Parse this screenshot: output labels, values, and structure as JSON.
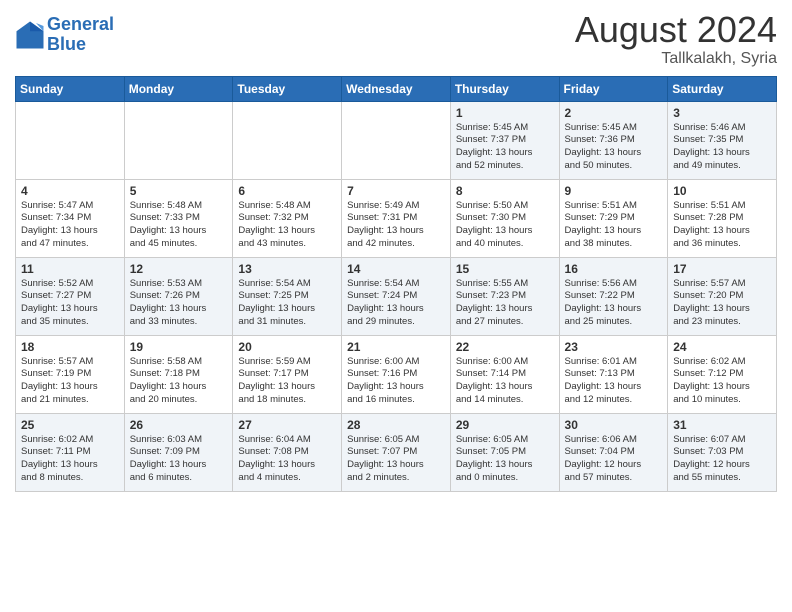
{
  "header": {
    "logo_line1": "General",
    "logo_line2": "Blue",
    "month_year": "August 2024",
    "location": "Tallkalakh, Syria"
  },
  "weekdays": [
    "Sunday",
    "Monday",
    "Tuesday",
    "Wednesday",
    "Thursday",
    "Friday",
    "Saturday"
  ],
  "weeks": [
    [
      {
        "day": "",
        "info": ""
      },
      {
        "day": "",
        "info": ""
      },
      {
        "day": "",
        "info": ""
      },
      {
        "day": "",
        "info": ""
      },
      {
        "day": "1",
        "info": "Sunrise: 5:45 AM\nSunset: 7:37 PM\nDaylight: 13 hours\nand 52 minutes."
      },
      {
        "day": "2",
        "info": "Sunrise: 5:45 AM\nSunset: 7:36 PM\nDaylight: 13 hours\nand 50 minutes."
      },
      {
        "day": "3",
        "info": "Sunrise: 5:46 AM\nSunset: 7:35 PM\nDaylight: 13 hours\nand 49 minutes."
      }
    ],
    [
      {
        "day": "4",
        "info": "Sunrise: 5:47 AM\nSunset: 7:34 PM\nDaylight: 13 hours\nand 47 minutes."
      },
      {
        "day": "5",
        "info": "Sunrise: 5:48 AM\nSunset: 7:33 PM\nDaylight: 13 hours\nand 45 minutes."
      },
      {
        "day": "6",
        "info": "Sunrise: 5:48 AM\nSunset: 7:32 PM\nDaylight: 13 hours\nand 43 minutes."
      },
      {
        "day": "7",
        "info": "Sunrise: 5:49 AM\nSunset: 7:31 PM\nDaylight: 13 hours\nand 42 minutes."
      },
      {
        "day": "8",
        "info": "Sunrise: 5:50 AM\nSunset: 7:30 PM\nDaylight: 13 hours\nand 40 minutes."
      },
      {
        "day": "9",
        "info": "Sunrise: 5:51 AM\nSunset: 7:29 PM\nDaylight: 13 hours\nand 38 minutes."
      },
      {
        "day": "10",
        "info": "Sunrise: 5:51 AM\nSunset: 7:28 PM\nDaylight: 13 hours\nand 36 minutes."
      }
    ],
    [
      {
        "day": "11",
        "info": "Sunrise: 5:52 AM\nSunset: 7:27 PM\nDaylight: 13 hours\nand 35 minutes."
      },
      {
        "day": "12",
        "info": "Sunrise: 5:53 AM\nSunset: 7:26 PM\nDaylight: 13 hours\nand 33 minutes."
      },
      {
        "day": "13",
        "info": "Sunrise: 5:54 AM\nSunset: 7:25 PM\nDaylight: 13 hours\nand 31 minutes."
      },
      {
        "day": "14",
        "info": "Sunrise: 5:54 AM\nSunset: 7:24 PM\nDaylight: 13 hours\nand 29 minutes."
      },
      {
        "day": "15",
        "info": "Sunrise: 5:55 AM\nSunset: 7:23 PM\nDaylight: 13 hours\nand 27 minutes."
      },
      {
        "day": "16",
        "info": "Sunrise: 5:56 AM\nSunset: 7:22 PM\nDaylight: 13 hours\nand 25 minutes."
      },
      {
        "day": "17",
        "info": "Sunrise: 5:57 AM\nSunset: 7:20 PM\nDaylight: 13 hours\nand 23 minutes."
      }
    ],
    [
      {
        "day": "18",
        "info": "Sunrise: 5:57 AM\nSunset: 7:19 PM\nDaylight: 13 hours\nand 21 minutes."
      },
      {
        "day": "19",
        "info": "Sunrise: 5:58 AM\nSunset: 7:18 PM\nDaylight: 13 hours\nand 20 minutes."
      },
      {
        "day": "20",
        "info": "Sunrise: 5:59 AM\nSunset: 7:17 PM\nDaylight: 13 hours\nand 18 minutes."
      },
      {
        "day": "21",
        "info": "Sunrise: 6:00 AM\nSunset: 7:16 PM\nDaylight: 13 hours\nand 16 minutes."
      },
      {
        "day": "22",
        "info": "Sunrise: 6:00 AM\nSunset: 7:14 PM\nDaylight: 13 hours\nand 14 minutes."
      },
      {
        "day": "23",
        "info": "Sunrise: 6:01 AM\nSunset: 7:13 PM\nDaylight: 13 hours\nand 12 minutes."
      },
      {
        "day": "24",
        "info": "Sunrise: 6:02 AM\nSunset: 7:12 PM\nDaylight: 13 hours\nand 10 minutes."
      }
    ],
    [
      {
        "day": "25",
        "info": "Sunrise: 6:02 AM\nSunset: 7:11 PM\nDaylight: 13 hours\nand 8 minutes."
      },
      {
        "day": "26",
        "info": "Sunrise: 6:03 AM\nSunset: 7:09 PM\nDaylight: 13 hours\nand 6 minutes."
      },
      {
        "day": "27",
        "info": "Sunrise: 6:04 AM\nSunset: 7:08 PM\nDaylight: 13 hours\nand 4 minutes."
      },
      {
        "day": "28",
        "info": "Sunrise: 6:05 AM\nSunset: 7:07 PM\nDaylight: 13 hours\nand 2 minutes."
      },
      {
        "day": "29",
        "info": "Sunrise: 6:05 AM\nSunset: 7:05 PM\nDaylight: 13 hours\nand 0 minutes."
      },
      {
        "day": "30",
        "info": "Sunrise: 6:06 AM\nSunset: 7:04 PM\nDaylight: 12 hours\nand 57 minutes."
      },
      {
        "day": "31",
        "info": "Sunrise: 6:07 AM\nSunset: 7:03 PM\nDaylight: 12 hours\nand 55 minutes."
      }
    ]
  ]
}
